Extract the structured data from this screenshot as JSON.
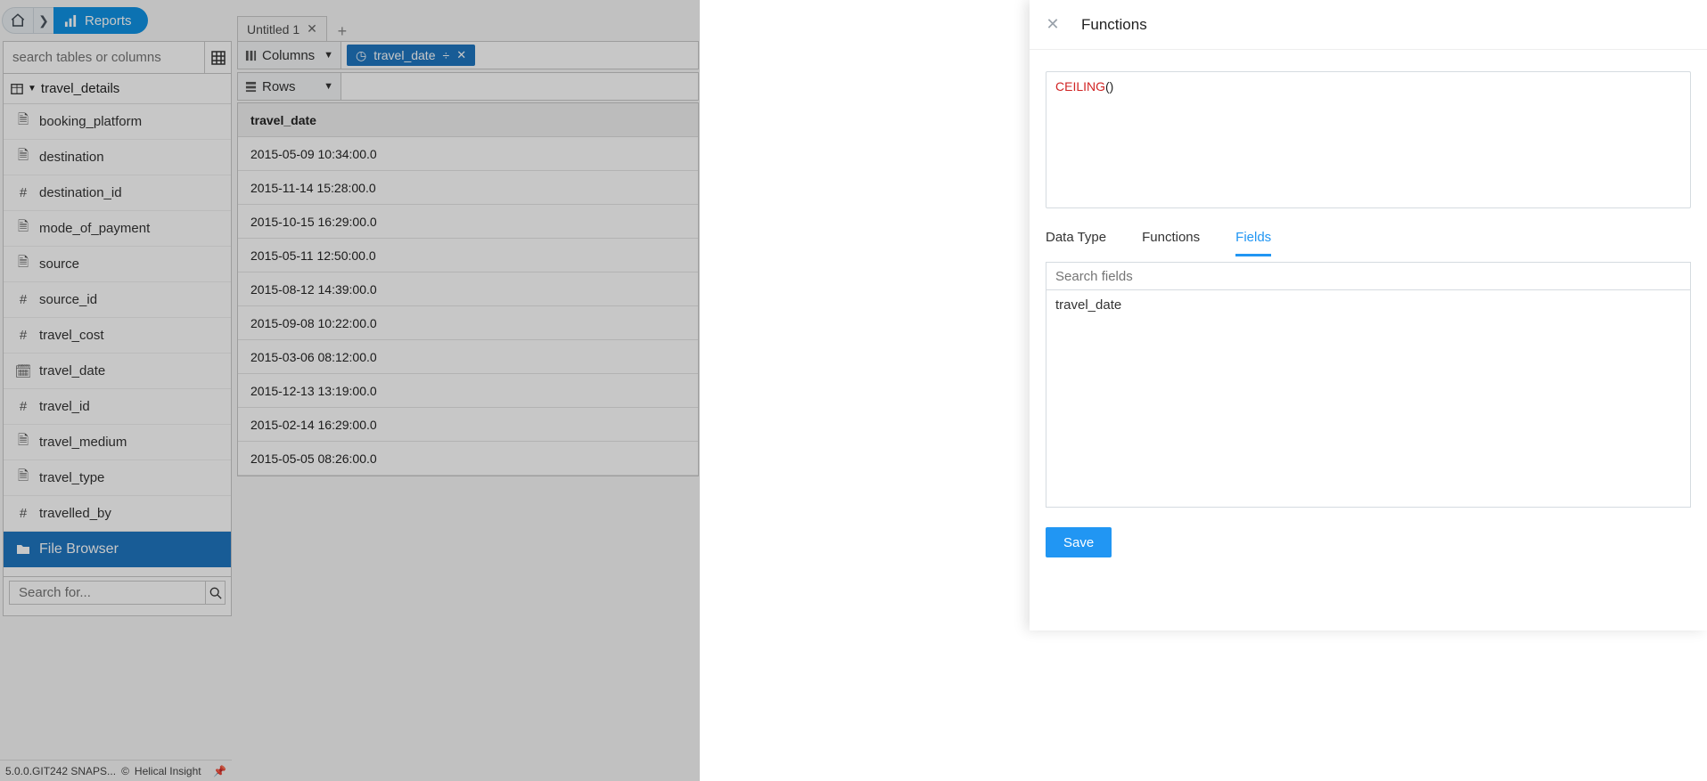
{
  "topnav": {
    "reports_label": "Reports"
  },
  "sidebar": {
    "search_placeholder": "search tables or columns",
    "table_name": "travel_details",
    "fields": [
      {
        "icon": "text",
        "label": "booking_platform"
      },
      {
        "icon": "text",
        "label": "destination"
      },
      {
        "icon": "num",
        "label": "destination_id"
      },
      {
        "icon": "text",
        "label": "mode_of_payment"
      },
      {
        "icon": "text",
        "label": "source"
      },
      {
        "icon": "num",
        "label": "source_id"
      },
      {
        "icon": "num",
        "label": "travel_cost"
      },
      {
        "icon": "date",
        "label": "travel_date"
      },
      {
        "icon": "num",
        "label": "travel_id"
      },
      {
        "icon": "text",
        "label": "travel_medium"
      },
      {
        "icon": "text",
        "label": "travel_type"
      },
      {
        "icon": "num",
        "label": "travelled_by"
      }
    ],
    "file_browser_label": "File Browser",
    "search_for_placeholder": "Search for..."
  },
  "footer": {
    "version": "5.0.0.GIT242 SNAPS...",
    "brand": "Helical Insight"
  },
  "tabs": {
    "title": "Untitled 1"
  },
  "shelves": {
    "columns_label": "Columns",
    "rows_label": "Rows",
    "column_pill": "travel_date"
  },
  "table": {
    "header": "travel_date",
    "rows": [
      "2015-05-09 10:34:00.0",
      "2015-11-14 15:28:00.0",
      "2015-10-15 16:29:00.0",
      "2015-05-11 12:50:00.0",
      "2015-08-12 14:39:00.0",
      "2015-09-08 10:22:00.0",
      "2015-03-06 08:12:00.0",
      "2015-12-13 13:19:00.0",
      "2015-02-14 16:29:00.0",
      "2015-05-05 08:26:00.0"
    ]
  },
  "panel": {
    "title": "Functions",
    "editor_fn": "CEILING",
    "editor_rest": "()",
    "tab_datatype": "Data Type",
    "tab_functions": "Functions",
    "tab_fields": "Fields",
    "fields_search_placeholder": "Search fields",
    "fields": [
      "travel_date"
    ],
    "save_label": "Save"
  }
}
